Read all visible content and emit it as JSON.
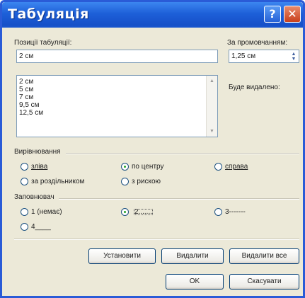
{
  "window": {
    "title": "Табуляція",
    "help_label": "?",
    "close_label": "✕"
  },
  "positions": {
    "label": "Позиції табуляції:",
    "current_value": "2 см",
    "items": [
      "2 см",
      "5 см",
      "7 см",
      "9,5 см",
      "12,5 см"
    ]
  },
  "default_stops": {
    "label": "За промовчанням:",
    "value": "1,25 см"
  },
  "to_be_removed": {
    "label": "Буде видалено:"
  },
  "alignment": {
    "label": "Вирівнювання",
    "options": [
      "зліва",
      "по центру",
      "справа",
      "за роздільником",
      "з рискою"
    ],
    "selected": "по центру"
  },
  "leader": {
    "label": "Заповнювач",
    "options": [
      "1 (немає)",
      "2.......",
      "3-------",
      "4____"
    ],
    "selected": "2......."
  },
  "buttons": {
    "set": "Установити",
    "clear": "Видалити",
    "clear_all": "Видалити все",
    "ok": "OK",
    "cancel": "Скасувати"
  }
}
